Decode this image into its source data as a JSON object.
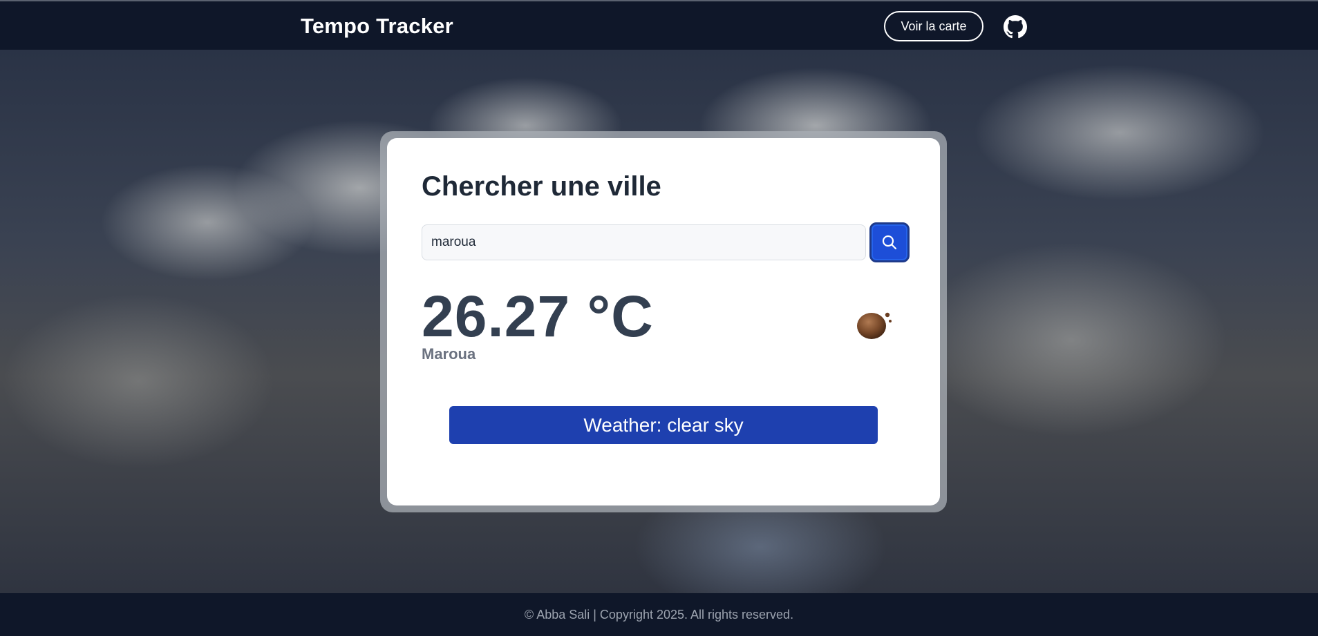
{
  "header": {
    "brand": "Tempo Tracker",
    "map_button_label": "Voir la carte",
    "github_icon": "github-icon"
  },
  "search": {
    "title": "Chercher une ville",
    "value": "maroua",
    "button_icon": "search-icon"
  },
  "weather": {
    "temperature": "26.27 °C",
    "city": "Maroua",
    "icon": "clear-sky-icon",
    "description": "Weather: clear sky"
  },
  "footer": {
    "text": "© Abba Sali | Copyright 2025. All rights reserved."
  },
  "colors": {
    "navbar": "#0f1729",
    "accent": "#1e40af",
    "search_button": "#1d4ed8",
    "card": "#ffffff"
  }
}
